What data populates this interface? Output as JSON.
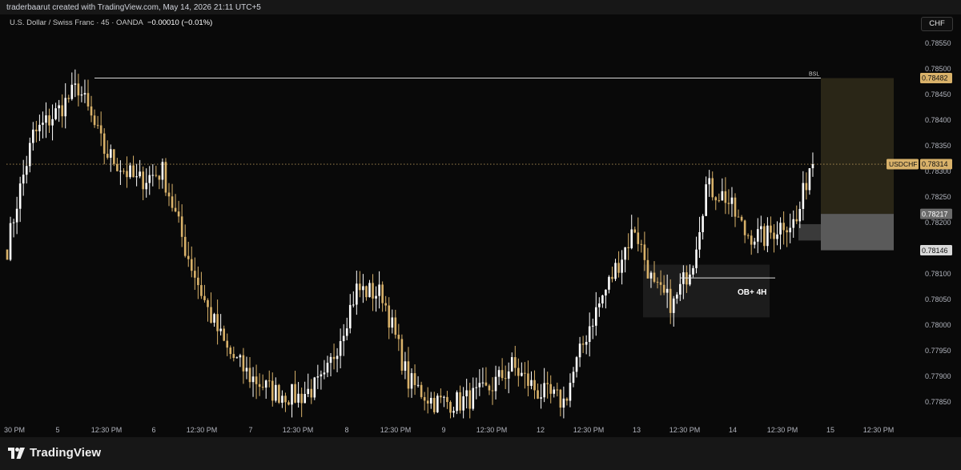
{
  "header": {
    "caption": "traderbaarut created with TradingView.com, May 14, 2026 21:11 UTC+5",
    "symbol_desc": "U.S. Dollar / Swiss Franc · 45 · OANDA",
    "symbol_change": "−0.00010 (−0.01%)",
    "currency_button": "CHF"
  },
  "footer": {
    "logo_text": "TradingView"
  },
  "colors": {
    "background": "#090909",
    "bull_candle": "#ffffff",
    "bear_candle": "#d9b26a",
    "current_price": "#d9b26a",
    "grid_text": "#b2b5be"
  },
  "chart_data": {
    "type": "candlestick",
    "symbol": "USDCHF",
    "timeframe": "45",
    "ylim": [
      0.77815,
      0.78588
    ],
    "y_ticks": [
      "0.78550",
      "0.78500",
      "0.78450",
      "0.78400",
      "0.78350",
      "0.78300",
      "0.78250",
      "0.78200",
      "0.78150",
      "0.78100",
      "0.78050",
      "0.78000",
      "0.77950",
      "0.77900",
      "0.77850"
    ],
    "x_ticks": [
      "30 PM",
      "5",
      "12:30 PM",
      "6",
      "12:30 PM",
      "7",
      "12:30 PM",
      "8",
      "12:30 PM",
      "9",
      "12:30 PM",
      "12",
      "12:30 PM",
      "13",
      "12:30 PM",
      "14",
      "12:30 PM",
      "15",
      "12:30 PM"
    ],
    "price_labels": [
      {
        "text": "0.78482",
        "price": 0.78482,
        "style": "gold"
      },
      {
        "symbol": "USDCHF",
        "text": "0.78314",
        "price": 0.78314,
        "style": "gold"
      },
      {
        "text": "0.78217",
        "price": 0.78217,
        "style": "grey"
      },
      {
        "text": "0.78146",
        "price": 0.78146,
        "style": "light"
      }
    ],
    "annotations": {
      "bsl_label": "BSL",
      "bsl_price": 0.78482,
      "ob_label": "OB+ 4H",
      "ob_zone": [
        0.78015,
        0.78118
      ],
      "ob_level": 0.78092,
      "position_entry": 0.78217,
      "position_target": 0.78482,
      "position_stop": 0.78146
    },
    "key_points": [
      {
        "t": 0,
        "p": 0.7815
      },
      {
        "t": 3,
        "p": 0.7824
      },
      {
        "t": 8,
        "p": 0.7837
      },
      {
        "t": 16,
        "p": 0.7842
      },
      {
        "t": 22,
        "p": 0.78465
      },
      {
        "t": 30,
        "p": 0.7834
      },
      {
        "t": 40,
        "p": 0.7828
      },
      {
        "t": 48,
        "p": 0.783
      },
      {
        "t": 55,
        "p": 0.7815
      },
      {
        "t": 62,
        "p": 0.7803
      },
      {
        "t": 68,
        "p": 0.7795
      },
      {
        "t": 75,
        "p": 0.779
      },
      {
        "t": 82,
        "p": 0.7787
      },
      {
        "t": 90,
        "p": 0.7786
      },
      {
        "t": 98,
        "p": 0.7789
      },
      {
        "t": 108,
        "p": 0.7807
      },
      {
        "t": 116,
        "p": 0.7806
      },
      {
        "t": 124,
        "p": 0.7789
      },
      {
        "t": 132,
        "p": 0.7785
      },
      {
        "t": 140,
        "p": 0.7785
      },
      {
        "t": 148,
        "p": 0.7787
      },
      {
        "t": 156,
        "p": 0.7792
      },
      {
        "t": 164,
        "p": 0.7787
      },
      {
        "t": 172,
        "p": 0.7785
      },
      {
        "t": 180,
        "p": 0.78
      },
      {
        "t": 188,
        "p": 0.7811
      },
      {
        "t": 194,
        "p": 0.7819
      },
      {
        "t": 200,
        "p": 0.7807
      },
      {
        "t": 206,
        "p": 0.7804
      },
      {
        "t": 212,
        "p": 0.7813
      },
      {
        "t": 216,
        "p": 0.7827
      },
      {
        "t": 222,
        "p": 0.7825
      },
      {
        "t": 228,
        "p": 0.7818
      },
      {
        "t": 234,
        "p": 0.7817
      },
      {
        "t": 240,
        "p": 0.782
      },
      {
        "t": 244,
        "p": 0.782
      },
      {
        "t": 248,
        "p": 0.7831
      }
    ]
  }
}
